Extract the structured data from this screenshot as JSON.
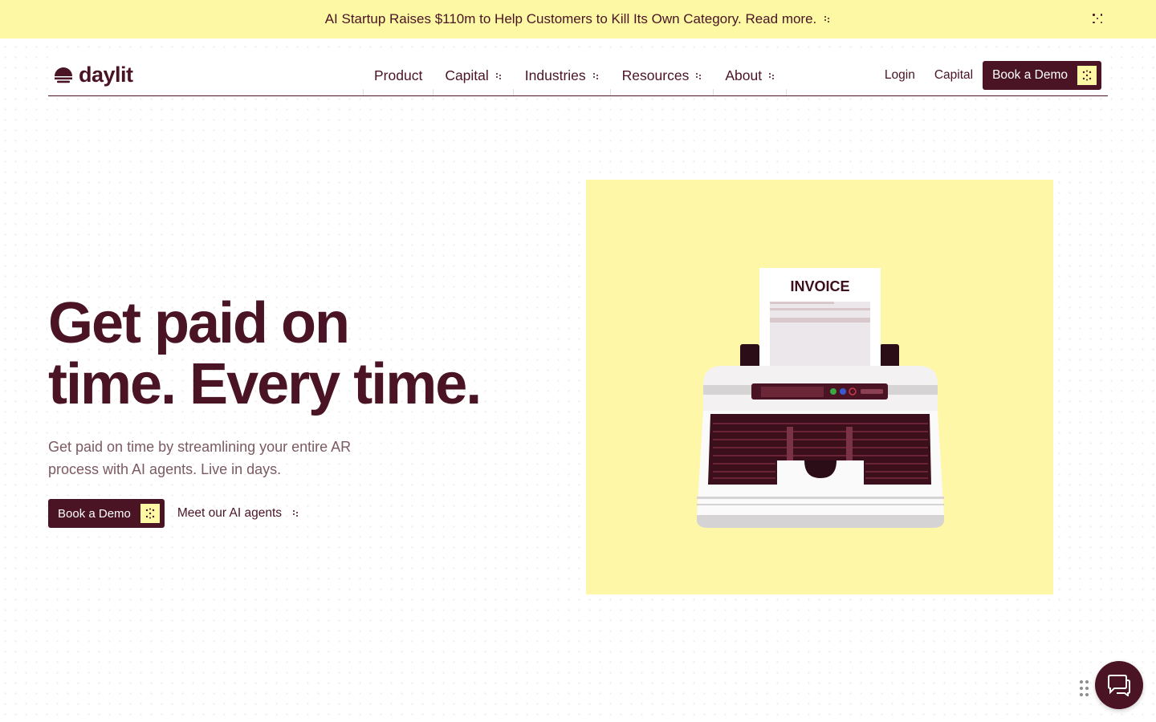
{
  "announcement": {
    "text": "AI Startup Raises $110m to Help Customers to Kill Its Own Category. Read more.",
    "close_icon": "close-dots-icon"
  },
  "header": {
    "logo_text": "daylit",
    "nav": [
      {
        "label": "Product",
        "has_menu": false
      },
      {
        "label": "Capital",
        "has_menu": true
      },
      {
        "label": "Industries",
        "has_menu": true
      },
      {
        "label": "Resources",
        "has_menu": true
      },
      {
        "label": "About",
        "has_menu": true
      }
    ],
    "login_label": "Login",
    "capital_label": "Capital",
    "demo_label": "Book a Demo"
  },
  "hero": {
    "title_line1": "Get paid on",
    "title_line2": "time. Every time.",
    "subtitle": "Get paid on time by streamlining your entire AR process with AI agents. Live in days.",
    "demo_label": "Book a Demo",
    "agents_label": "Meet our AI agents"
  },
  "illustration": {
    "invoice_label": "INVOICE",
    "background": "#fef7a7"
  },
  "colors": {
    "brand": "#4a1424",
    "accent_yellow": "#fdf8a4",
    "subtext": "#7c5a62"
  },
  "chat": {
    "icon": "chat-bubble-icon"
  }
}
